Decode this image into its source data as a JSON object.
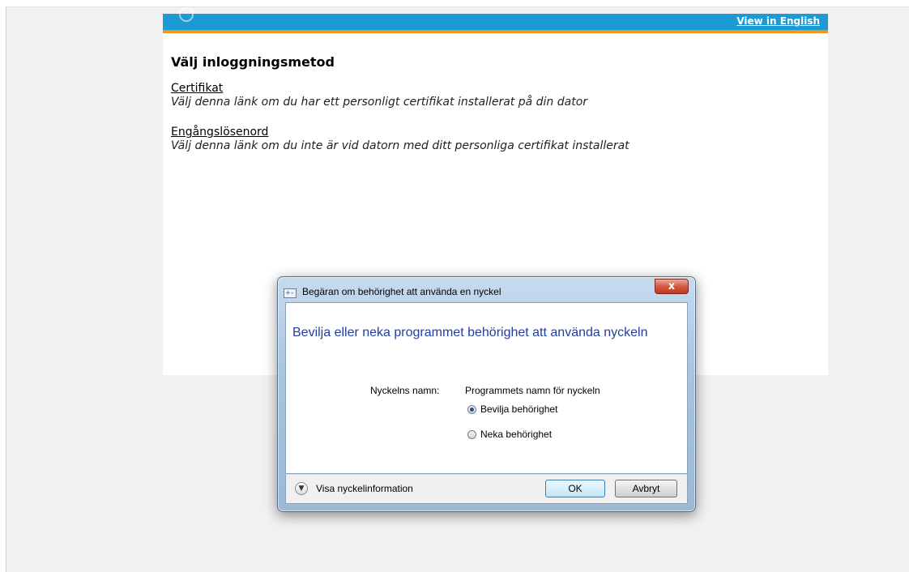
{
  "page": {
    "lang_link": "View in English",
    "heading": "Välj inloggningsmetod",
    "methods": [
      {
        "label": "Certifikat",
        "description": "Välj denna länk om du har ett personligt certifikat installerat på din dator"
      },
      {
        "label": "Engångslösenord",
        "description": "Välj denna länk om du inte är vid datorn med ditt personliga certifikat installerat"
      }
    ]
  },
  "dialog": {
    "title": "Begäran om behörighet att använda en nyckel",
    "close_glyph": "x",
    "main_instruction": "Bevilja eller neka programmet behörighet att använda nyckeln",
    "key_name_label": "Nyckelns namn:",
    "key_name_value": "Programmets namn för nyckeln",
    "options": [
      {
        "label": "Bevilja behörighet",
        "selected": true
      },
      {
        "label": "Neka behörighet",
        "selected": false
      }
    ],
    "details_label": "Visa nyckelinformation",
    "ok_label": "OK",
    "cancel_label": "Avbryt"
  },
  "colors": {
    "topbar": "#1b9ad6",
    "topbar_accent": "#f39321",
    "instruction_text": "#1f3f9e"
  }
}
